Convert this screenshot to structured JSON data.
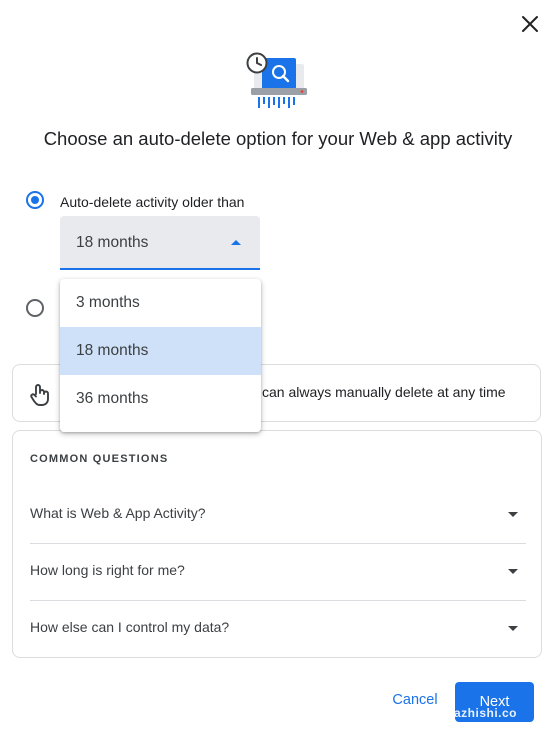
{
  "dialog": {
    "title": "Choose an auto-delete option for your Web & app activity"
  },
  "options": {
    "auto_delete_label": "Auto-delete activity older than",
    "selected_value": "18 months"
  },
  "dropdown": {
    "items": [
      {
        "label": "3 months"
      },
      {
        "label": "18 months"
      },
      {
        "label": "36 months"
      }
    ]
  },
  "info": {
    "text": "can always manually delete at any time"
  },
  "faq": {
    "heading": "COMMON QUESTIONS",
    "questions": [
      {
        "label": "What is Web & App Activity?"
      },
      {
        "label": "How long is right for me?"
      },
      {
        "label": "How else can I control my data?"
      }
    ]
  },
  "actions": {
    "cancel_label": "Cancel",
    "next_label": "Next"
  },
  "watermark": "azhishi.co",
  "colors": {
    "accent": "#1a73e8",
    "selected_bg": "#cfe1f8",
    "border": "#dadce0"
  }
}
